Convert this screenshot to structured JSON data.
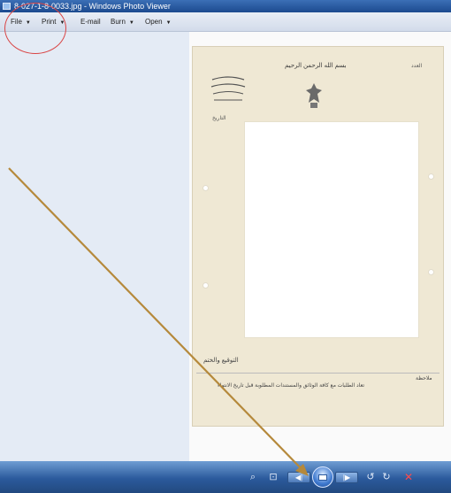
{
  "window": {
    "title": "8-027-1-8-0033.jpg - Windows Photo Viewer"
  },
  "menu": [
    {
      "label": "File",
      "has_arrow": true
    },
    {
      "label": "Print",
      "has_arrow": true
    },
    {
      "label": "E-mail",
      "has_arrow": false
    },
    {
      "label": "Burn",
      "has_arrow": true
    },
    {
      "label": "Open",
      "has_arrow": true
    }
  ],
  "document": {
    "arabic_header": "بسم الله الرحمن الرحيم",
    "arabic_ref": "العدد",
    "arabic_date": "التاريخ",
    "arabic_signature": "التوقيع والختم",
    "arabic_footer_note": "ملاحظة",
    "arabic_footer_text": "تعاد الطلبات مع كافة الوثائق والمستندات المطلوبة قبل تاريخ الانتهاء"
  },
  "controls": {
    "zoom_icon": "magnifier-icon",
    "fit_icon": "fit-window-icon",
    "prev_icon": "previous-icon",
    "slideshow_icon": "slideshow-icon",
    "next_icon": "next-icon",
    "rotate_ccw_icon": "rotate-counterclockwise-icon",
    "rotate_cw_icon": "rotate-clockwise-icon",
    "delete_icon": "delete-icon"
  },
  "colors": {
    "annotation": "#d94545",
    "arrow": "#b5893b",
    "taskbar": "#2b5a9c"
  }
}
